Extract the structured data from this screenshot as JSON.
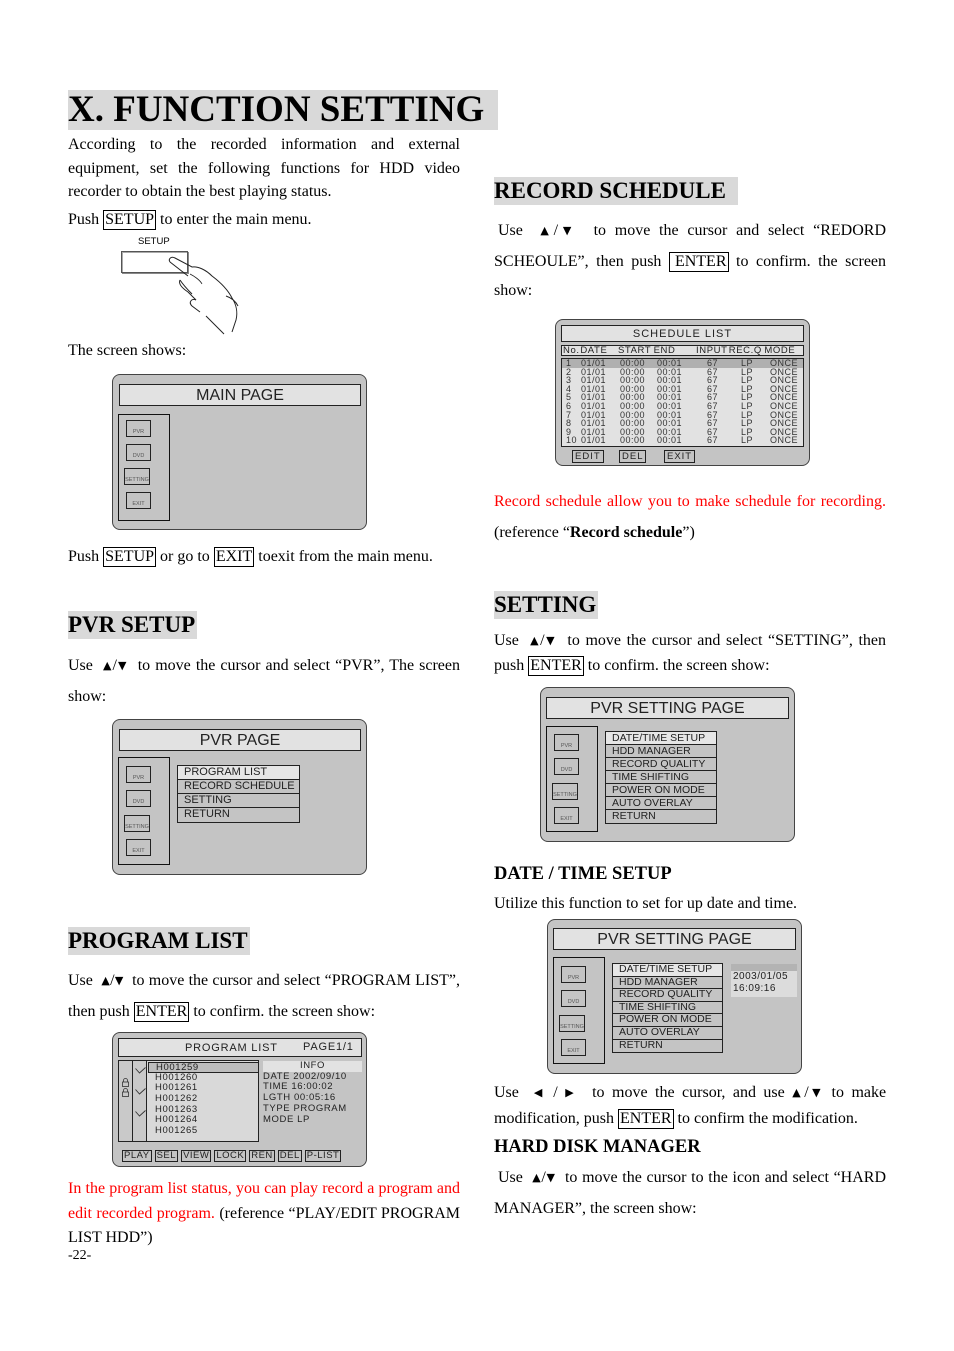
{
  "page": {
    "title": "X. FUNCTION SETTING",
    "page_number": "-22-"
  },
  "intro": {
    "paragraph": "According to the recorded information and external equipment, set the following functions for HDD video recorder to obtain the best playing status.",
    "push_prefix": "Push",
    "setup_key": "SETUP",
    "push_suffix": "to enter the main menu.",
    "remote_button_label": "SETUP",
    "screen_shows": "The screen shows:"
  },
  "main_page_screen": {
    "title": "MAIN PAGE",
    "icons": [
      "PVR",
      "DVD",
      "SETTING",
      "EXIT"
    ]
  },
  "exit_note": {
    "prefix": "Push",
    "setup_key": "SETUP",
    "middle": "or go to",
    "exit_key": "EXIT",
    "suffix": "toexit from the main menu."
  },
  "pvr_setup": {
    "heading": "PVR SETUP",
    "use": "Use",
    "up_arrow": "▲",
    "slash": "/",
    "down_arrow": "▼",
    "text": "to move the cursor and select “PVR”, The screen show:",
    "screen": {
      "title": "PVR  PAGE",
      "icons": [
        "PVR",
        "DVD",
        "SETTING",
        "EXIT"
      ],
      "menu": [
        "PROGRAM LIST",
        "RECORD SCHEDULE",
        "SETTING",
        "RETURN"
      ],
      "selected_index": 0
    }
  },
  "program_list": {
    "heading": "PROGRAM LIST",
    "use": "Use",
    "text_1": "to move the cursor and select “PROGRAM LIST”, then push",
    "enter_key": "ENTER",
    "text_2": "to confirm. the screen show:",
    "screen": {
      "title": "PROGRAM LIST",
      "page": "PAGE1/1",
      "programs": [
        {
          "name": "H001259",
          "locked": false,
          "checked": true,
          "selected": true
        },
        {
          "name": "H001260",
          "locked": true,
          "checked": false,
          "selected": false
        },
        {
          "name": "H001261",
          "locked": true,
          "checked": true,
          "selected": false
        },
        {
          "name": "H001262",
          "locked": false,
          "checked": false,
          "selected": false
        },
        {
          "name": "H001263",
          "locked": false,
          "checked": true,
          "selected": false
        },
        {
          "name": "H001264",
          "locked": false,
          "checked": false,
          "selected": false
        },
        {
          "name": "H001265",
          "locked": false,
          "checked": false,
          "selected": false
        }
      ],
      "info_title": "INFO",
      "info": [
        "DATE 2002/09/10",
        "TIME  16:00:02",
        "LGTH 00:05:16",
        "TYPE  PROGRAM",
        "MODE  LP"
      ],
      "buttons": [
        "PLAY",
        "SEL",
        "VIEW",
        "LOCK",
        "REN",
        "DEL",
        "P-LIST"
      ]
    },
    "note_red": "In the program list status, you can play record a program and edit recorded program.",
    "note_ref": "(reference “PLAY/EDIT PROGRAM LIST HDD”)"
  },
  "record_schedule": {
    "heading": "RECORD SCHEDULE",
    "use": "Use",
    "text_1": "to move the cursor and select “REDORD SCHEOULE”, then push",
    "enter_key": "ENTER",
    "text_2": "to confirm. the screen show:",
    "screen": {
      "title": "SCHEDULE LIST",
      "columns": [
        "No.",
        "DATE",
        "START",
        "END",
        "INPUT",
        "REC.Q",
        "MODE"
      ],
      "rows": [
        [
          "1",
          "01/01",
          "00:00",
          "00:01",
          "67",
          "LP",
          "ONCE"
        ],
        [
          "2",
          "01/01",
          "00:00",
          "00:01",
          "67",
          "LP",
          "ONCE"
        ],
        [
          "3",
          "01/01",
          "00:00",
          "00:01",
          "67",
          "LP",
          "ONCE"
        ],
        [
          "4",
          "01/01",
          "00:00",
          "00:01",
          "67",
          "LP",
          "ONCE"
        ],
        [
          "5",
          "01/01",
          "00:00",
          "00:01",
          "67",
          "LP",
          "ONCE"
        ],
        [
          "6",
          "01/01",
          "00:00",
          "00:01",
          "67",
          "LP",
          "ONCE"
        ],
        [
          "7",
          "01/01",
          "00:00",
          "00:01",
          "67",
          "LP",
          "ONCE"
        ],
        [
          "8",
          "01/01",
          "00:00",
          "00:01",
          "67",
          "LP",
          "ONCE"
        ],
        [
          "9",
          "01/01",
          "00:00",
          "00:01",
          "67",
          "LP",
          "ONCE"
        ],
        [
          "10",
          "01/01",
          "00:00",
          "00:01",
          "67",
          "LP",
          "ONCE"
        ]
      ],
      "buttons": [
        "EDIT",
        "DEL",
        "EXIT"
      ]
    },
    "note_red": "Record schedule allow you to make schedule for recording.",
    "note_ref_prefix": "(reference “",
    "note_ref_bold": "Record schedule",
    "note_ref_suffix": "”)"
  },
  "setting": {
    "heading": "SETTING",
    "use": "Use",
    "text_1": "to move the cursor and select “SETTING”, then push",
    "enter_key": "ENTER",
    "text_2": "to confirm. the screen show:",
    "screen": {
      "title": "PVR SETTING PAGE",
      "icons": [
        "PVR",
        "DVD",
        "SETTING",
        "EXIT"
      ],
      "menu": [
        "DATE/TIME SETUP",
        "HDD MANAGER",
        "RECORD QUALITY",
        "TIME SHIFTING",
        "POWER ON MODE",
        "AUTO OVERLAY",
        "RETURN"
      ],
      "selected_index": 0
    }
  },
  "date_time": {
    "heading": "DATE / TIME SETUP",
    "text": "Utilize this function to set for up date and time.",
    "screen": {
      "title": "PVR SETTING PAGE",
      "icons": [
        "PVR",
        "DVD",
        "SETTING",
        "EXIT"
      ],
      "menu": [
        "DATE/TIME SETUP",
        "HDD MANAGER",
        "RECORD QUALITY",
        "TIME SHIFTING",
        "POWER ON MODE",
        "AUTO OVERLAY",
        "RETURN"
      ],
      "selected_index": 0,
      "date": "2003/01/05",
      "time": "16:09:16"
    },
    "use": "Use",
    "left_arrow": "◀",
    "right_arrow": "▶",
    "text_1": "to move the cursor, and use",
    "text_2": "to make modification, push",
    "enter_key": "ENTER",
    "text_3": "to confirm the modification."
  },
  "hdd_manager": {
    "heading": "HARD DISK MANAGER",
    "use": "Use",
    "text": "to move the cursor to the icon and select “HARD MANAGER”, the screen show:"
  }
}
